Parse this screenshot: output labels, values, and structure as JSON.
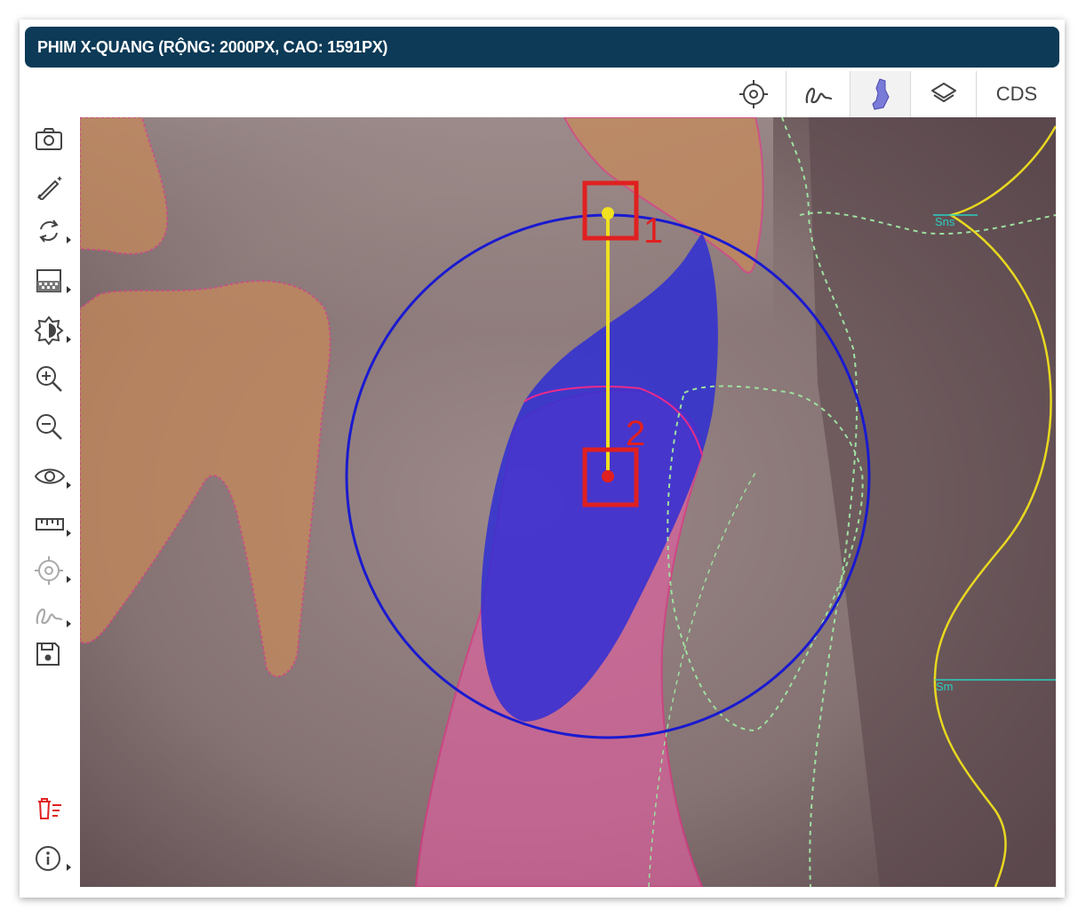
{
  "window": {
    "title": "PHIM X-QUANG (RỘNG: 2000PX, CAO: 1591PX)"
  },
  "toolbar": {
    "items": [
      {
        "icon": "target-icon"
      },
      {
        "icon": "curve-icon"
      },
      {
        "icon": "tooth-icon",
        "active": true
      },
      {
        "icon": "layers-icon"
      },
      {
        "icon": "cds-text",
        "label": "CDS"
      }
    ]
  },
  "sidebar": {
    "items": [
      {
        "icon": "camera-icon",
        "has_submenu": false
      },
      {
        "icon": "magic-pen-icon",
        "has_submenu": false
      },
      {
        "icon": "rotate-icon",
        "has_submenu": true
      },
      {
        "icon": "contrast-grid-icon",
        "has_submenu": true
      },
      {
        "icon": "brightness-icon",
        "has_submenu": true
      },
      {
        "icon": "zoom-in-icon",
        "has_submenu": false
      },
      {
        "icon": "zoom-out-icon",
        "has_submenu": false
      },
      {
        "icon": "eye-icon",
        "has_submenu": true
      },
      {
        "icon": "ruler-icon",
        "has_submenu": true
      },
      {
        "icon": "target-icon",
        "has_submenu": true,
        "disabled": true
      },
      {
        "icon": "curve-icon",
        "has_submenu": true,
        "disabled": true
      },
      {
        "icon": "save-icon",
        "has_submenu": false
      },
      {
        "icon": "delete-list-icon",
        "has_submenu": false,
        "color": "#e02020"
      },
      {
        "icon": "info-icon",
        "has_submenu": true
      }
    ]
  },
  "annotations": {
    "marker1": "1",
    "marker2": "2",
    "landmark_top": "Sns",
    "landmark_bottom": "Sm"
  },
  "colors": {
    "title_bar": "#0c3a57",
    "highlight_box": "#e02020",
    "measure_line": "#f0e020",
    "circle": "#1a1ad0",
    "tooth_mask": "#2b2bd8",
    "root_mask": "#e060a0",
    "adjacent_tooth": "#c88a5a",
    "profile_line": "#e8d820"
  }
}
